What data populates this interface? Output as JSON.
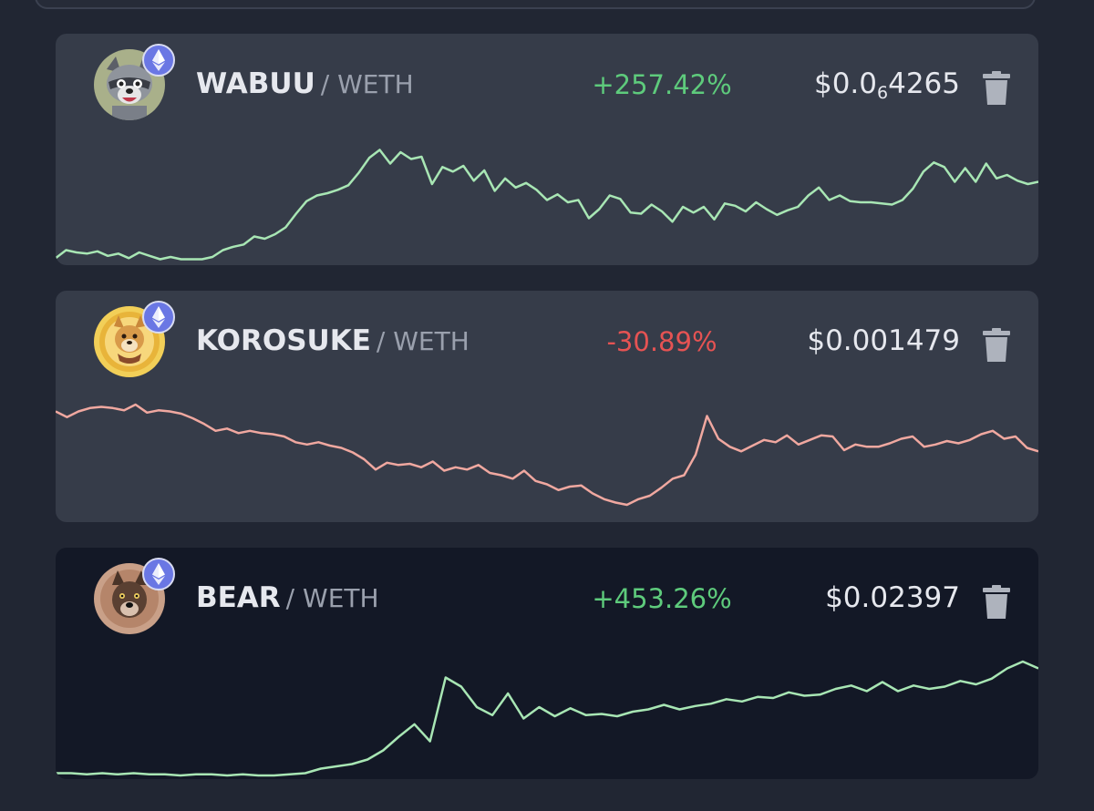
{
  "colors": {
    "page_bg": "#212633",
    "card_bg": "#363c49",
    "card_bg_active": "#131826",
    "positive": "#5ecb7c",
    "negative": "#e65353",
    "line_up": "#a8e6b4",
    "line_down": "#f0a8a0"
  },
  "pairs": [
    {
      "symbol": "WABUU",
      "quote": "/ WETH",
      "change": "+257.42%",
      "direction": "up",
      "price_prefix": "$0.0",
      "price_zero_count": "6",
      "price_digits": "4265",
      "chain_icon": "ethereum-icon",
      "avatar": "raccoon-avatar",
      "sparkline": [
        0.97,
        0.9,
        0.92,
        0.93,
        0.91,
        0.95,
        0.93,
        0.97,
        0.92,
        0.95,
        0.98,
        0.96,
        0.98,
        0.98,
        0.98,
        0.96,
        0.9,
        0.87,
        0.85,
        0.78,
        0.8,
        0.76,
        0.7,
        0.58,
        0.47,
        0.42,
        0.4,
        0.37,
        0.33,
        0.22,
        0.09,
        0.02,
        0.14,
        0.04,
        0.1,
        0.08,
        0.32,
        0.17,
        0.21,
        0.16,
        0.29,
        0.2,
        0.38,
        0.27,
        0.35,
        0.31,
        0.37,
        0.46,
        0.41,
        0.48,
        0.46,
        0.62,
        0.54,
        0.42,
        0.45,
        0.57,
        0.58,
        0.5,
        0.56,
        0.65,
        0.52,
        0.57,
        0.52,
        0.63,
        0.49,
        0.51,
        0.56,
        0.48,
        0.54,
        0.59,
        0.55,
        0.52,
        0.42,
        0.35,
        0.46,
        0.42,
        0.47,
        0.48,
        0.48,
        0.49,
        0.5,
        0.46,
        0.36,
        0.21,
        0.13,
        0.17,
        0.3,
        0.18,
        0.3,
        0.14,
        0.27,
        0.24,
        0.29,
        0.32,
        0.3
      ],
      "sparkline_range": [
        0,
        1
      ]
    },
    {
      "symbol": "KOROSUKE",
      "quote": "/ WETH",
      "change": "-30.89%",
      "direction": "down",
      "price": "$0.001479",
      "chain_icon": "ethereum-icon",
      "avatar": "shiba-avatar",
      "sparkline": [
        0.06,
        0.11,
        0.06,
        0.03,
        0.02,
        0.03,
        0.05,
        0.0,
        0.07,
        0.05,
        0.06,
        0.08,
        0.12,
        0.17,
        0.23,
        0.21,
        0.25,
        0.23,
        0.25,
        0.26,
        0.28,
        0.33,
        0.35,
        0.33,
        0.36,
        0.38,
        0.42,
        0.48,
        0.57,
        0.51,
        0.53,
        0.52,
        0.55,
        0.5,
        0.58,
        0.55,
        0.57,
        0.53,
        0.6,
        0.62,
        0.65,
        0.58,
        0.67,
        0.7,
        0.75,
        0.72,
        0.71,
        0.78,
        0.83,
        0.86,
        0.88,
        0.83,
        0.8,
        0.73,
        0.65,
        0.62,
        0.44,
        0.1,
        0.3,
        0.37,
        0.41,
        0.36,
        0.31,
        0.33,
        0.27,
        0.35,
        0.31,
        0.27,
        0.28,
        0.4,
        0.35,
        0.37,
        0.37,
        0.34,
        0.3,
        0.28,
        0.37,
        0.35,
        0.32,
        0.34,
        0.31,
        0.26,
        0.23,
        0.3,
        0.28,
        0.38,
        0.41
      ],
      "sparkline_range": [
        0,
        1
      ]
    },
    {
      "symbol": "BEAR",
      "quote": "/ WETH",
      "change": "+453.26%",
      "direction": "up",
      "price": "$0.02397",
      "chain_icon": "ethereum-icon",
      "avatar": "dog-avatar",
      "sparkline": [
        0.98,
        0.98,
        0.99,
        0.98,
        0.99,
        0.98,
        0.99,
        0.99,
        1.0,
        0.99,
        0.99,
        1.0,
        0.99,
        1.0,
        1.0,
        0.99,
        0.98,
        0.94,
        0.92,
        0.9,
        0.86,
        0.78,
        0.66,
        0.55,
        0.7,
        0.14,
        0.22,
        0.4,
        0.47,
        0.28,
        0.5,
        0.4,
        0.48,
        0.41,
        0.47,
        0.46,
        0.48,
        0.44,
        0.42,
        0.38,
        0.42,
        0.39,
        0.37,
        0.33,
        0.35,
        0.31,
        0.32,
        0.27,
        0.3,
        0.29,
        0.24,
        0.21,
        0.26,
        0.18,
        0.26,
        0.21,
        0.24,
        0.22,
        0.17,
        0.2,
        0.15,
        0.06,
        0.0,
        0.06
      ],
      "sparkline_range": [
        0,
        1
      ]
    }
  ]
}
